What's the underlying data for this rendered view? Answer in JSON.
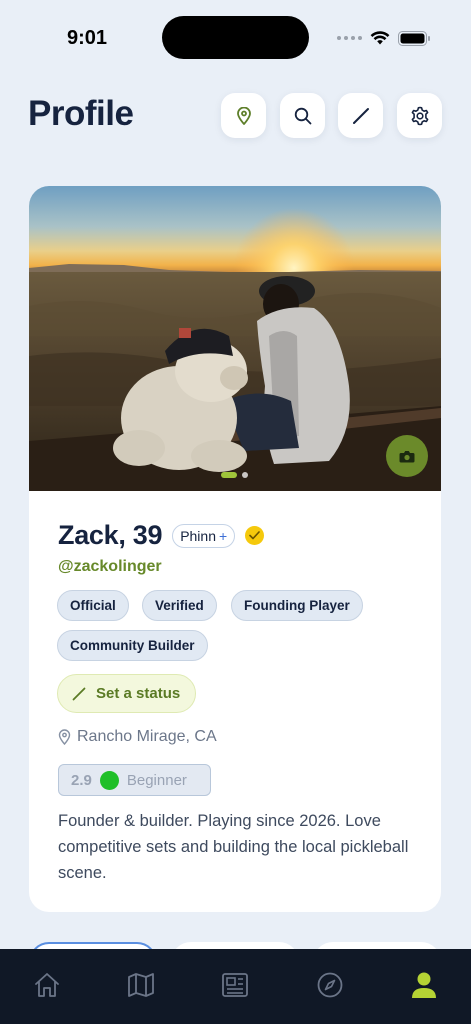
{
  "status_bar": {
    "time": "9:01"
  },
  "header": {
    "title": "Profile",
    "buttons": [
      "location-pin",
      "search",
      "edit",
      "settings"
    ]
  },
  "profile": {
    "name": "Zack, 39",
    "tag": "Phinn",
    "tag_plus": "+",
    "handle": "@zackolinger",
    "badges": [
      "Official",
      "Verified",
      "Founding Player",
      "Community Builder"
    ],
    "set_status": "Set a status",
    "location": "Rancho Mirage, CA",
    "rating": "2.9",
    "level": "Beginner",
    "bio": "Founder & builder. Playing since 2026. Love competitive sets and building the local pickleball scene.",
    "photo_pages": 2,
    "photo_active": 1
  },
  "tabbar": {
    "items": [
      "home",
      "map",
      "news",
      "explore",
      "profile"
    ],
    "active": "profile"
  },
  "colors": {
    "background": "#e9eff7",
    "navy": "#16233f",
    "accent_green": "#67892a",
    "camera_green": "#6b8a2a",
    "tab_active": "#b5d334",
    "tabbar": "#101826",
    "level_dot": "#1fbf28",
    "verified": "#f5c90c"
  }
}
